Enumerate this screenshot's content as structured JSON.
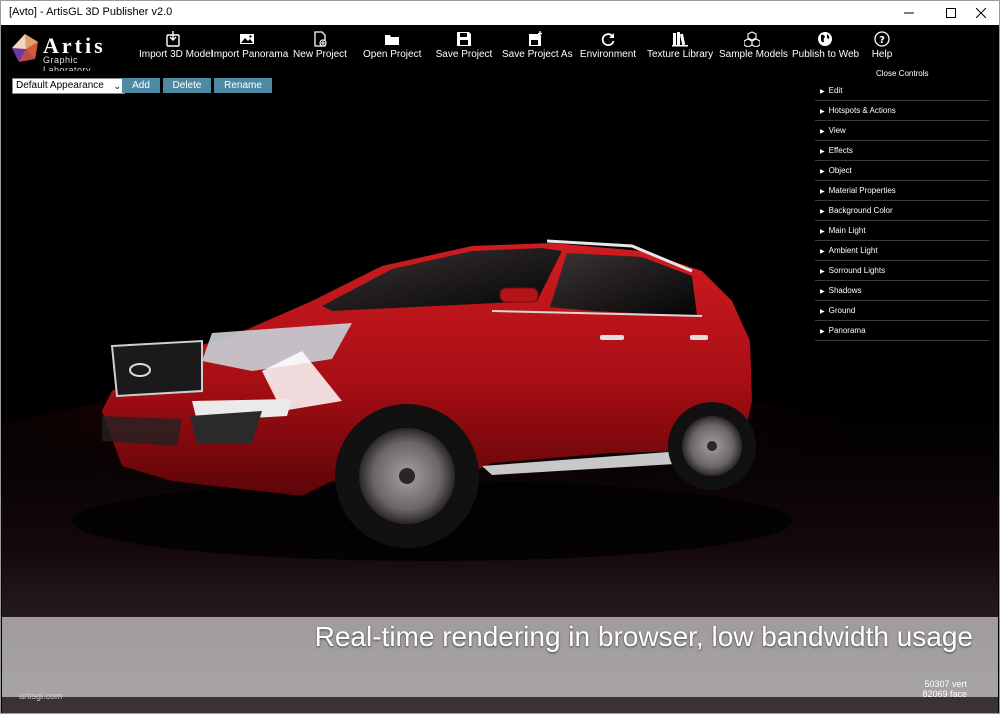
{
  "window": {
    "title": "[Avto] - ArtisGL 3D Publisher v2.0"
  },
  "logo": {
    "word": "Artis",
    "sub": "Graphic Laboratory"
  },
  "toolbar": {
    "items": [
      {
        "label": "Import 3D Model",
        "icon": "import-model-icon"
      },
      {
        "label": "Import Panorama",
        "icon": "image-icon"
      },
      {
        "label": "New Project",
        "icon": "new-file-icon"
      },
      {
        "label": "Open Project",
        "icon": "folder-icon"
      },
      {
        "label": "Save Project",
        "icon": "save-icon"
      },
      {
        "label": "Save Project As",
        "icon": "save-as-icon"
      },
      {
        "label": "Environment",
        "icon": "refresh-icon"
      },
      {
        "label": "Texture Library",
        "icon": "books-icon"
      },
      {
        "label": "Sample Models",
        "icon": "cubes-icon"
      },
      {
        "label": "Publish to Web",
        "icon": "globe-icon"
      },
      {
        "label": "Help",
        "icon": "help-icon"
      }
    ]
  },
  "appearance": {
    "selected": "Default Appearance",
    "add": "Add",
    "delete": "Delete",
    "rename": "Rename"
  },
  "controls": {
    "close_label": "Close Controls",
    "items": [
      "Edit",
      "Hotspots & Actions",
      "View",
      "Effects",
      "Object",
      "Material Properties",
      "Background Color",
      "Main Light",
      "Ambient Light",
      "Sorround Lights",
      "Shadows",
      "Ground",
      "Panorama"
    ]
  },
  "viewport": {
    "caption": "Real-time rendering in browser, low bandwidth usage",
    "watermark": "artisgl.com",
    "vertices": "50307 vert",
    "faces": "82069 face",
    "car_color": "#b01016",
    "accent": "#4e8aa4"
  }
}
